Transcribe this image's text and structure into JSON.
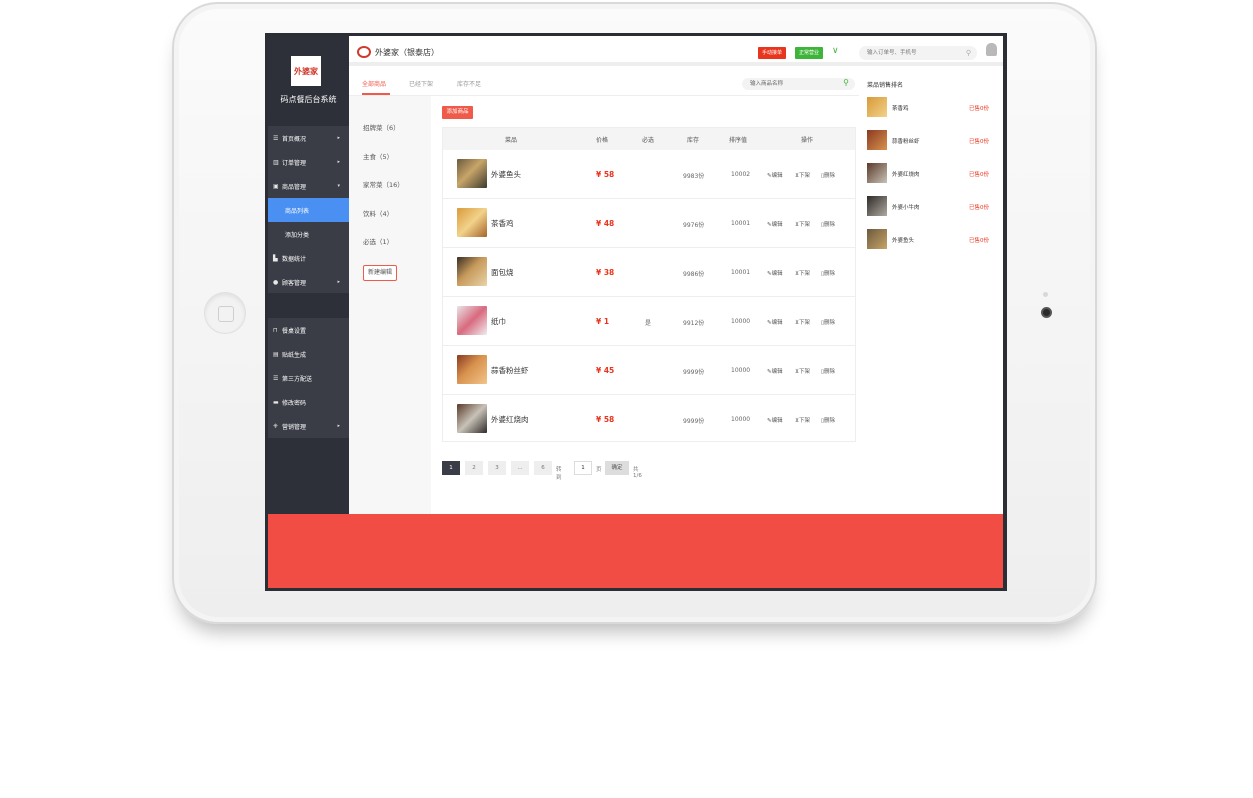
{
  "brand": {
    "logo_text": "外婆家",
    "system_title": "码点餐后台系统"
  },
  "sidebar": {
    "items": [
      {
        "label": "首页概况",
        "icon": "list-icon",
        "arrow": "▸"
      },
      {
        "label": "订单管理",
        "icon": "chart-icon",
        "arrow": "▸"
      },
      {
        "label": "商品管理",
        "icon": "box-icon",
        "arrow": "▾"
      },
      {
        "label": "商品列表",
        "icon": "",
        "arrow": ""
      },
      {
        "label": "添加分类",
        "icon": "",
        "arrow": ""
      },
      {
        "label": "数据统计",
        "icon": "bar-chart-icon",
        "arrow": ""
      },
      {
        "label": "顾客管理",
        "icon": "user-icon",
        "arrow": "▸"
      },
      {
        "label": "餐桌设置",
        "icon": "table-icon",
        "arrow": ""
      },
      {
        "label": "贴纸生成",
        "icon": "card-icon",
        "arrow": ""
      },
      {
        "label": "第三方配送",
        "icon": "list-icon",
        "arrow": ""
      },
      {
        "label": "修改密码",
        "icon": "lock-icon",
        "arrow": ""
      },
      {
        "label": "营销管理",
        "icon": "grid-icon",
        "arrow": "▸"
      }
    ]
  },
  "topbar": {
    "store_name": "外婆家（银泰店）",
    "manual_order_label": "手动接单",
    "status_label": "正常营业",
    "search_placeholder": "输入订单号、手机号"
  },
  "tabs": {
    "items": [
      "全部商品",
      "已经下架",
      "库存不足"
    ],
    "search_placeholder": "输入商品名称"
  },
  "categories": {
    "items": [
      "招牌菜（6）",
      "主食（5）",
      "家常菜（16）",
      "饮料（4）",
      "必选（1）"
    ],
    "new_button": "新建编辑"
  },
  "main": {
    "add_button": "添加商品",
    "columns": [
      "菜品",
      "价格",
      "必选",
      "库存",
      "排序值",
      "操作"
    ],
    "rows": [
      {
        "name": "外婆鱼头",
        "price": "¥ 58",
        "must": "",
        "stock": "9983份",
        "sort": "10002"
      },
      {
        "name": "茶香鸡",
        "price": "¥ 48",
        "must": "",
        "stock": "9976份",
        "sort": "10001"
      },
      {
        "name": "面包烧",
        "price": "¥ 38",
        "must": "",
        "stock": "9986份",
        "sort": "10001"
      },
      {
        "name": "纸巾",
        "price": "¥ 1",
        "must": "是",
        "stock": "9912份",
        "sort": "10000"
      },
      {
        "name": "蒜香粉丝虾",
        "price": "¥ 45",
        "must": "",
        "stock": "9999份",
        "sort": "10000"
      },
      {
        "name": "外婆红烧肉",
        "price": "¥ 58",
        "must": "",
        "stock": "9999份",
        "sort": "10000"
      }
    ],
    "actions": {
      "edit": "编辑",
      "offshelf": "下架",
      "delete": "删除"
    }
  },
  "pager": {
    "pages": [
      "1",
      "2",
      "3",
      "...",
      "6"
    ],
    "goto_label": "转到",
    "input_value": "1",
    "page_label": "页",
    "confirm_label": "确定",
    "total_label": "共1/6"
  },
  "rank": {
    "title": "菜品销售排名",
    "items": [
      {
        "name": "茶香鸡",
        "sold": "已售0份"
      },
      {
        "name": "蒜香粉丝虾",
        "sold": "已售0份"
      },
      {
        "name": "外婆红烧肉",
        "sold": "已售0份"
      },
      {
        "name": "外婆小牛肉",
        "sold": "已售0份"
      },
      {
        "name": "外婆鱼头",
        "sold": "已售0份"
      }
    ]
  },
  "colors": {
    "accent": "#f05a4a",
    "sidebar_bg": "#2d3038",
    "active_nav": "#4a8ff2",
    "status_green": "#3fb43a",
    "bottom_bar": "#f24d45"
  }
}
